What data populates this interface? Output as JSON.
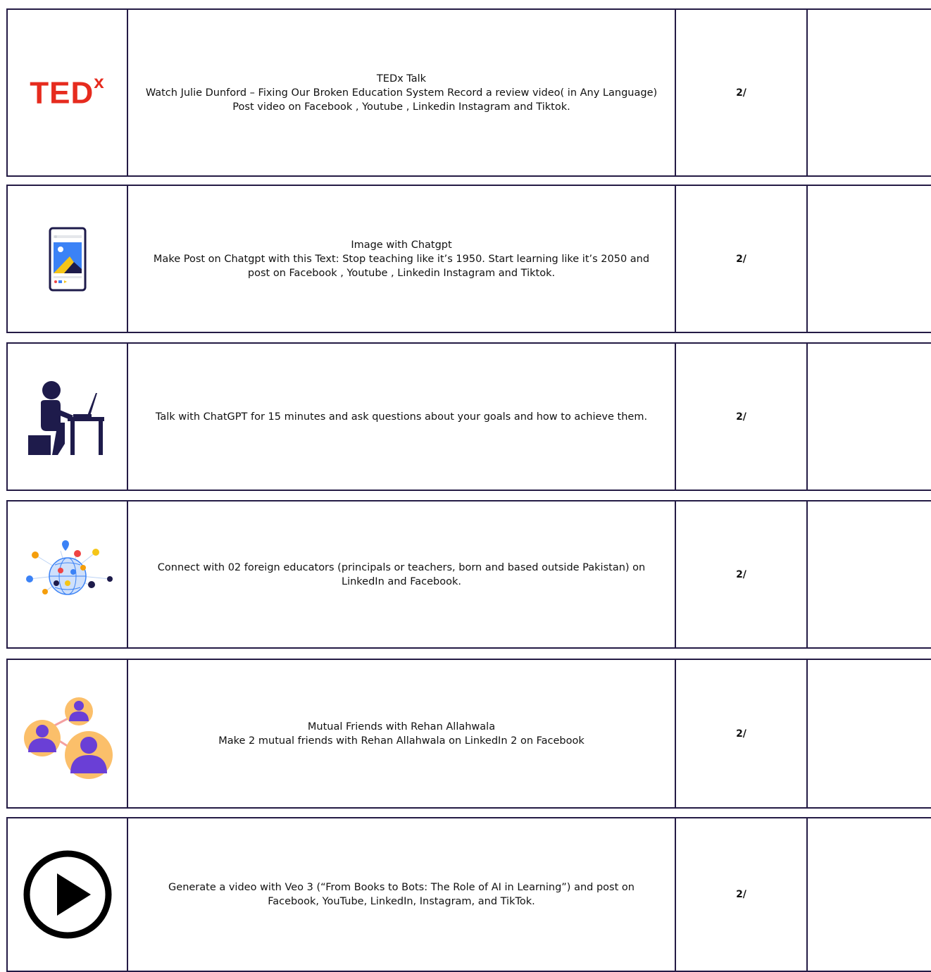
{
  "colors": {
    "border": "#241b45",
    "ted_red": "#e62b1e",
    "navy": "#1e1b4b",
    "purple": "#6a3fd6",
    "orange": "#fbbf6a",
    "blue": "#3b82f6",
    "yellow": "#f5c518"
  },
  "tasks": [
    {
      "icon": "tedx-logo-icon",
      "logo_text": "TED",
      "logo_sup": "x",
      "description": "TEDx Talk\nWatch Julie Dunford – Fixing Our Broken Education System Record a review video( in Any Language) Post video on Facebook , Youtube , Linkedin Instagram and Tiktok.",
      "score": "2/"
    },
    {
      "icon": "smartphone-image-post-icon",
      "description": "Image with Chatgpt\nMake Post on Chatgpt with this Text:  Stop teaching like it’s 1950. Start learning like it’s 2050 and post on Facebook , Youtube , Linkedin Instagram and Tiktok.",
      "score": "2/"
    },
    {
      "icon": "person-at-laptop-icon",
      "description": "Talk with ChatGPT for 15 minutes and ask questions about your goals and how to achieve them.",
      "score": "2/"
    },
    {
      "icon": "global-network-icon",
      "description": "Connect with 02 foreign educators (principals or teachers, born and based outside Pakistan) on LinkedIn and Facebook.",
      "score": "2/"
    },
    {
      "icon": "mutual-friends-icon",
      "description": "Mutual Friends with Rehan Allahwala\nMake 2 mutual friends with Rehan Allahwala on LinkedIn 2 on Facebook",
      "score": "2/"
    },
    {
      "icon": "play-button-icon",
      "description": "Generate a video with Veo 3 (“From Books to Bots: The Role of AI in Learning”) and post on Facebook, YouTube, LinkedIn, Instagram, and TikTok.",
      "score": "2/"
    }
  ]
}
